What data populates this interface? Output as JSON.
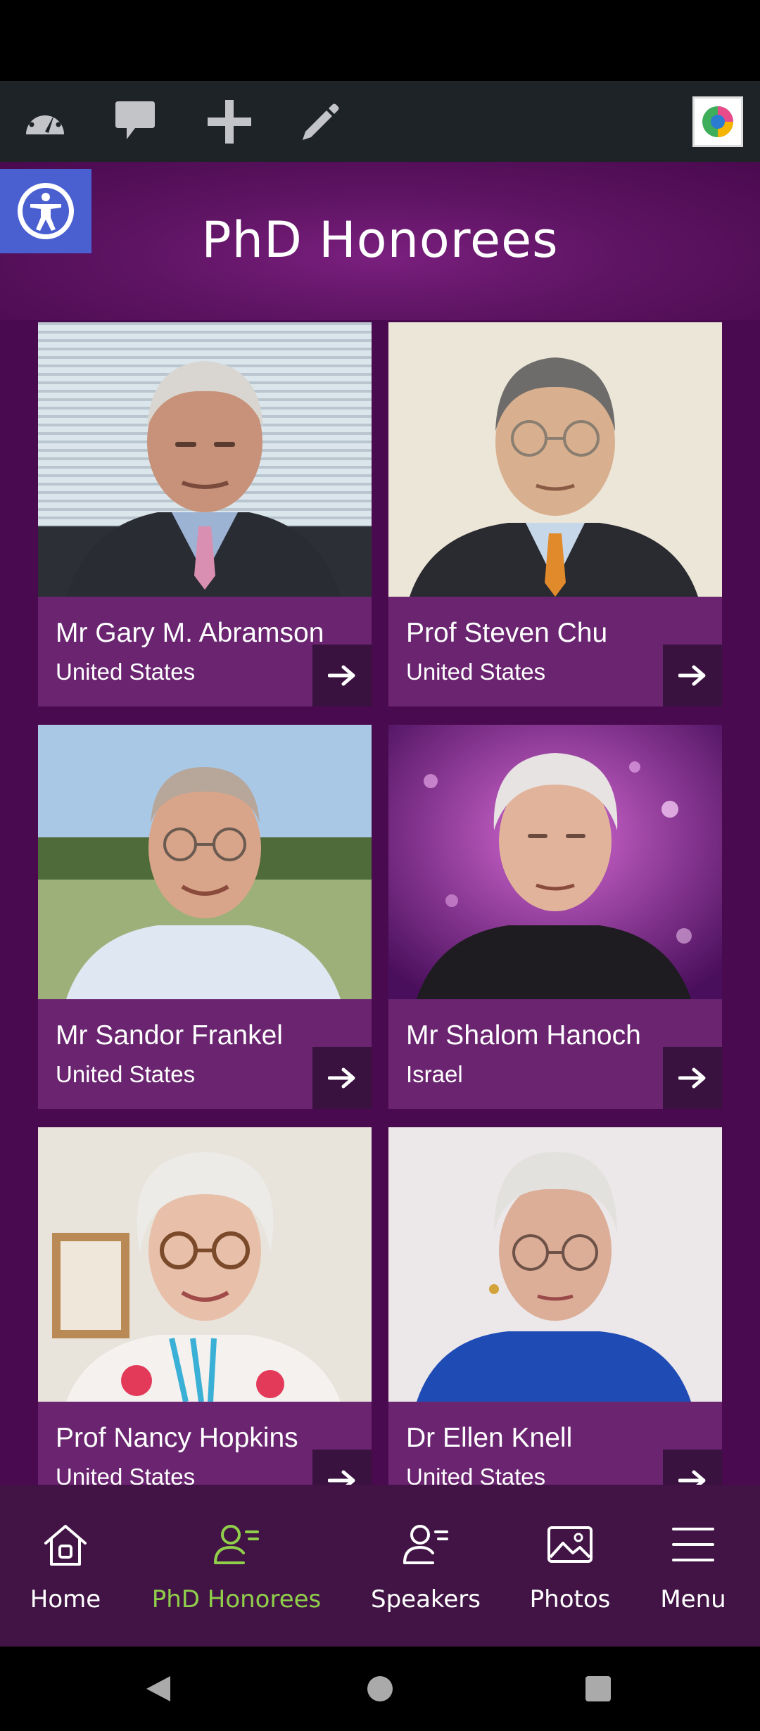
{
  "admin_bar": {
    "icons": [
      "dashboard-icon",
      "comment-icon",
      "plus-icon",
      "pencil-icon"
    ],
    "avatar": "site-avatar"
  },
  "header": {
    "title": "PhD Honorees",
    "accessibility_icon": "accessibility-icon"
  },
  "honorees": [
    {
      "name": "Mr Gary M. Abramson",
      "country": "United States"
    },
    {
      "name": "Prof Steven Chu",
      "country": "United States"
    },
    {
      "name": "Mr Sandor Frankel",
      "country": "United States"
    },
    {
      "name": "Mr Shalom Hanoch",
      "country": "Israel"
    },
    {
      "name": "Prof Nancy Hopkins",
      "country": "United States"
    },
    {
      "name": "Dr Ellen Knell",
      "country": "United States"
    }
  ],
  "bottom_nav": [
    {
      "label": "Home",
      "icon": "home-icon",
      "active": false
    },
    {
      "label": "PhD Honorees",
      "icon": "person-list-icon",
      "active": true
    },
    {
      "label": "Speakers",
      "icon": "person-list-icon",
      "active": false
    },
    {
      "label": "Photos",
      "icon": "photo-icon",
      "active": false
    },
    {
      "label": "Menu",
      "icon": "hamburger-icon",
      "active": false
    }
  ],
  "colors": {
    "page_bg": "#4a0a4f",
    "card_info_bg": "#6a2470",
    "arrow_bg": "#3a1240",
    "nav_bg": "#421445",
    "active_nav": "#8fcf4a",
    "admin_bg": "#1d2327",
    "a11y_bg": "#4a5fd0"
  }
}
